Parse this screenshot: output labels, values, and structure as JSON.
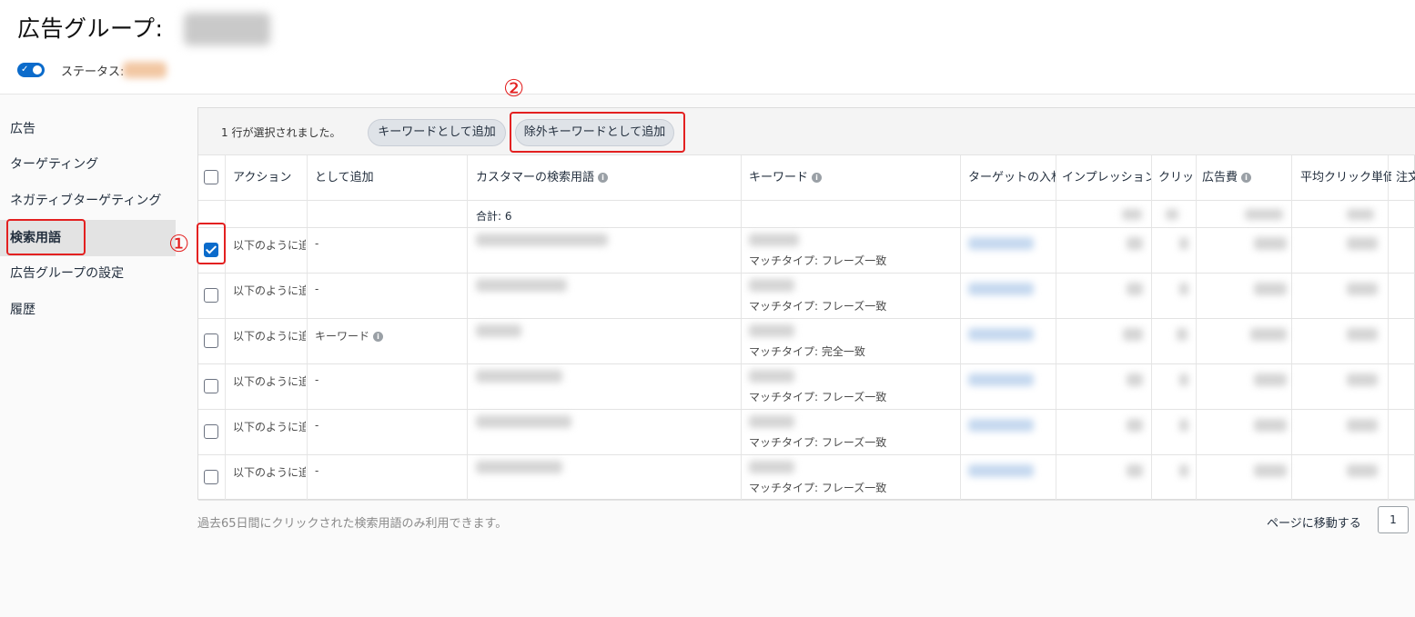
{
  "header": {
    "title": "広告グループ:",
    "status_label": "ステータス:"
  },
  "sidebar": {
    "items": [
      {
        "label": "広告"
      },
      {
        "label": "ターゲティング"
      },
      {
        "label": "ネガティブターゲティング"
      },
      {
        "label": "検索用語",
        "active": true
      },
      {
        "label": "広告グループの設定"
      },
      {
        "label": "履歴"
      }
    ]
  },
  "annotations": {
    "one": "①",
    "two": "②"
  },
  "toolbar": {
    "selection_text": "1 行が選択されました。",
    "add_keyword_label": "キーワードとして追加",
    "add_negative_label": "除外キーワードとして追加"
  },
  "table": {
    "columns": [
      "アクション",
      "として追加",
      "カスタマーの検索用語",
      "キーワード",
      "ターゲットの入札",
      "インプレッション",
      "クリック",
      "広告費",
      "平均クリック単価",
      "注文"
    ],
    "total_label": "合計: 6",
    "rows": [
      {
        "checked": true,
        "action": "以下のように追",
        "added_as": "-",
        "match_type": "マッチタイプ: フレーズ一致"
      },
      {
        "checked": false,
        "action": "以下のように追",
        "added_as": "-",
        "match_type": "マッチタイプ: フレーズ一致"
      },
      {
        "checked": false,
        "action": "以下のように追",
        "added_as": "キーワード",
        "match_type": "マッチタイプ: 完全一致"
      },
      {
        "checked": false,
        "action": "以下のように追",
        "added_as": "-",
        "match_type": "マッチタイプ: フレーズ一致"
      },
      {
        "checked": false,
        "action": "以下のように追",
        "added_as": "-",
        "match_type": "マッチタイプ: フレーズ一致"
      },
      {
        "checked": false,
        "action": "以下のように追",
        "added_as": "-",
        "match_type": "マッチタイプ: フレーズ一致"
      }
    ]
  },
  "footer": {
    "note": "過去65日間にクリックされた検索用語のみ利用できます。",
    "goto_label": "ページに移動する",
    "goto_value": "1"
  },
  "colors": {
    "accent": "#0b6bcb",
    "annotation": "#e32020"
  },
  "icons": [
    "toggle-switch",
    "info-icon",
    "checkbox"
  ]
}
